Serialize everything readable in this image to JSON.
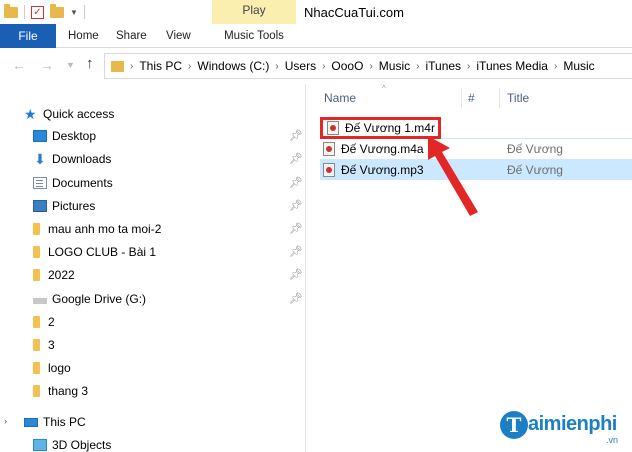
{
  "window": {
    "title": "NhacCuaTui.com"
  },
  "ribbon": {
    "file": "File",
    "home": "Home",
    "share": "Share",
    "view": "View",
    "contextual_label": "Play",
    "music_tools": "Music Tools"
  },
  "address": {
    "crumbs": [
      "This PC",
      "Windows (C:)",
      "Users",
      "OooO",
      "Music",
      "iTunes",
      "iTunes Media",
      "Music"
    ]
  },
  "nav": {
    "quick_access": "Quick access",
    "items": [
      {
        "label": "Desktop",
        "icon": "desktop-icon",
        "pinned": true
      },
      {
        "label": "Downloads",
        "icon": "downloads-icon",
        "pinned": true
      },
      {
        "label": "Documents",
        "icon": "documents-icon",
        "pinned": true
      },
      {
        "label": "Pictures",
        "icon": "pictures-icon",
        "pinned": true
      },
      {
        "label": "mau anh mo ta moi-2",
        "icon": "folder-icon",
        "pinned": true
      },
      {
        "label": "LOGO CLUB - Bài 1",
        "icon": "folder-icon",
        "pinned": true
      },
      {
        "label": "2022",
        "icon": "folder-icon",
        "pinned": true
      },
      {
        "label": "Google Drive (G:)",
        "icon": "drive-icon",
        "pinned": true
      },
      {
        "label": "2",
        "icon": "folder-icon",
        "pinned": false
      },
      {
        "label": "3",
        "icon": "folder-icon",
        "pinned": false
      },
      {
        "label": "logo",
        "icon": "folder-icon",
        "pinned": false
      },
      {
        "label": "thang 3",
        "icon": "folder-icon",
        "pinned": false
      }
    ],
    "this_pc": "This PC",
    "objects_3d": "3D Objects"
  },
  "files": {
    "columns": {
      "name": "Name",
      "number": "#",
      "title": "Title"
    },
    "renaming": {
      "value": "Đế Vương 1.m4r"
    },
    "rows": [
      {
        "name": "Đế Vương.m4a",
        "title": "Đế Vương",
        "selected": false
      },
      {
        "name": "Đế Vương.mp3",
        "title": "Đế Vương",
        "selected": true
      }
    ]
  },
  "watermark": {
    "brand": "aimienphi",
    "logo_letter": "T",
    "tld": ".vn"
  },
  "colors": {
    "file_tab": "#1a5fb4",
    "contextual_tab": "#fbefb0",
    "highlight_box": "#e32626",
    "selected_row": "#cce8ff"
  }
}
